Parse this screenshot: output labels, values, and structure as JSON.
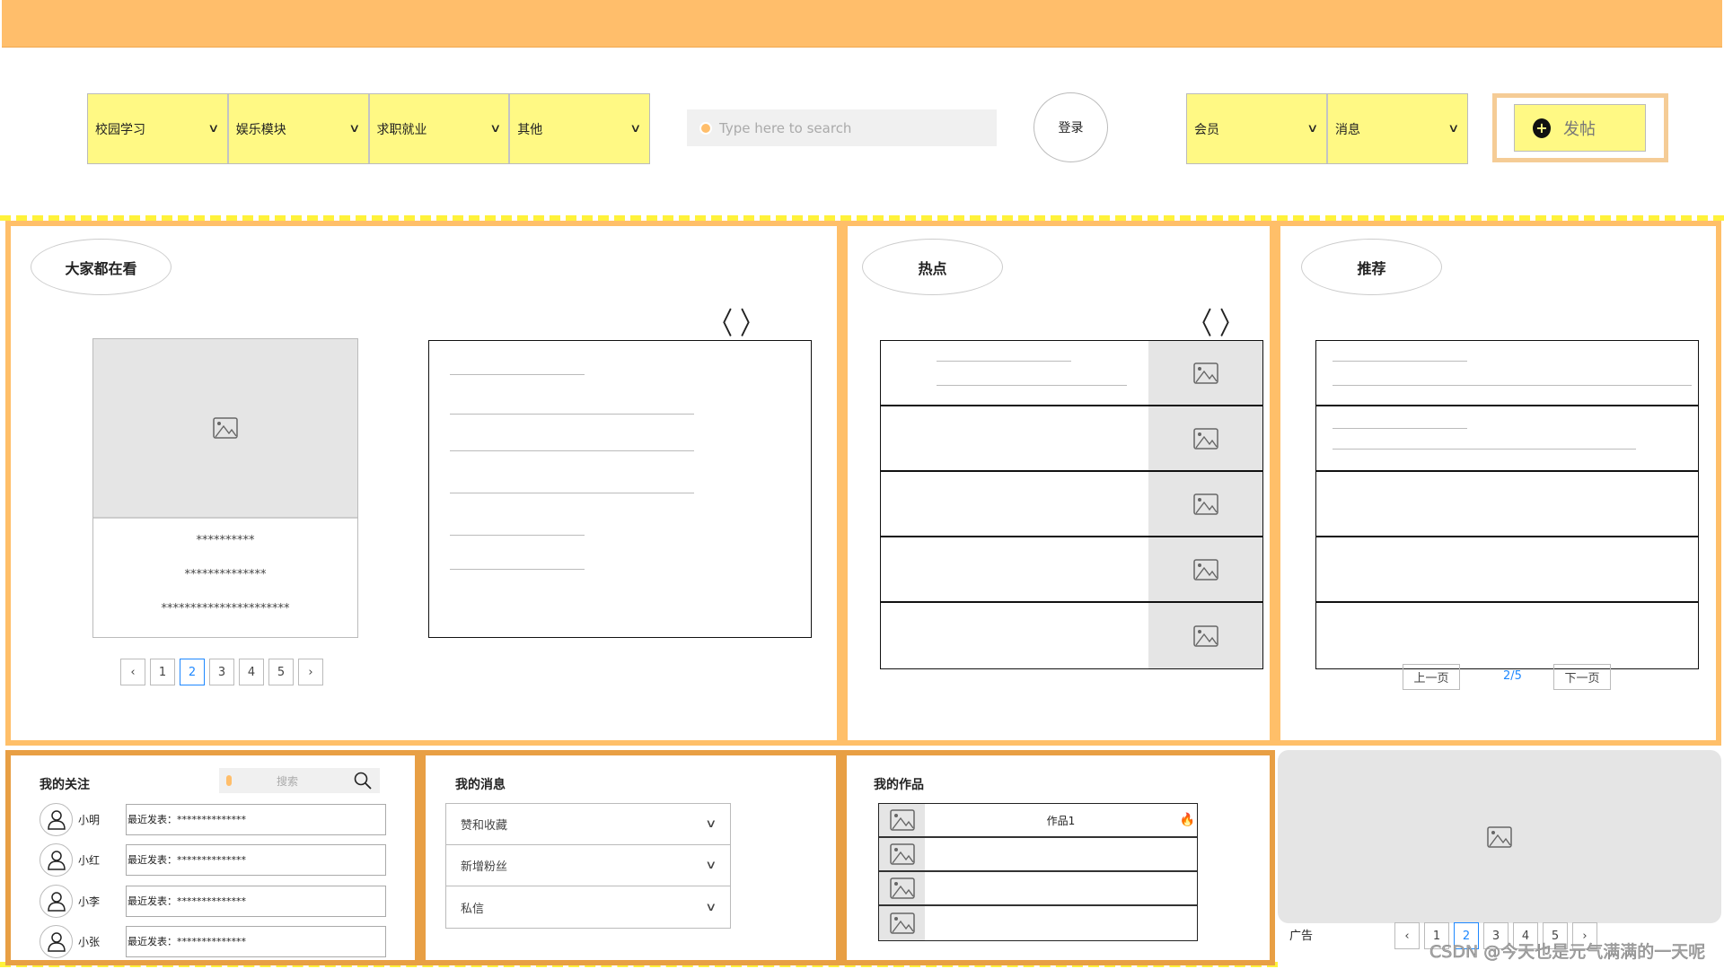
{
  "colors": {
    "topbar": "#ffbe6b",
    "nav_bg": "#fff984",
    "panel_border": "#ffbf69",
    "panel_border_dark": "#e89f44",
    "dashed": "#fff23a",
    "active_page": "#1e88ff"
  },
  "nav": {
    "items": [
      {
        "label": "校园学习"
      },
      {
        "label": "娱乐模块"
      },
      {
        "label": "求职就业"
      },
      {
        "label": "其他"
      }
    ]
  },
  "search": {
    "placeholder": "Type here to search"
  },
  "login_label": "登录",
  "user_nav": {
    "items": [
      {
        "label": "会员"
      },
      {
        "label": "消息"
      }
    ]
  },
  "post_label": "发帖",
  "popular": {
    "title": "大家都在看",
    "card_lines": [
      "**********",
      "**************",
      "**********************"
    ],
    "pages": [
      "1",
      "2",
      "3",
      "4",
      "5"
    ],
    "active_page": "2"
  },
  "hot": {
    "title": "热点"
  },
  "recommend": {
    "title": "推荐",
    "prev": "上一页",
    "next": "下一页",
    "page": "2/5"
  },
  "follow": {
    "title": "我的关注",
    "search_placeholder": "搜索",
    "items": [
      {
        "name": "小明",
        "recent": "最近发表：**************"
      },
      {
        "name": "小红",
        "recent": "最近发表：**************"
      },
      {
        "name": "小李",
        "recent": "最近发表：**************"
      },
      {
        "name": "小张",
        "recent": "最近发表：**************"
      }
    ]
  },
  "messages": {
    "title": "我的消息",
    "items": [
      {
        "label": "赞和收藏"
      },
      {
        "label": "新增粉丝"
      },
      {
        "label": "私信"
      }
    ]
  },
  "works": {
    "title": "我的作品",
    "items": [
      {
        "label": "作品1"
      },
      {
        "label": ""
      },
      {
        "label": ""
      },
      {
        "label": ""
      }
    ]
  },
  "ad": {
    "label": "广告",
    "pages": [
      "1",
      "2",
      "3",
      "4",
      "5"
    ],
    "active_page": "2"
  },
  "watermark": "CSDN @今天也是元气满满的一天呢"
}
